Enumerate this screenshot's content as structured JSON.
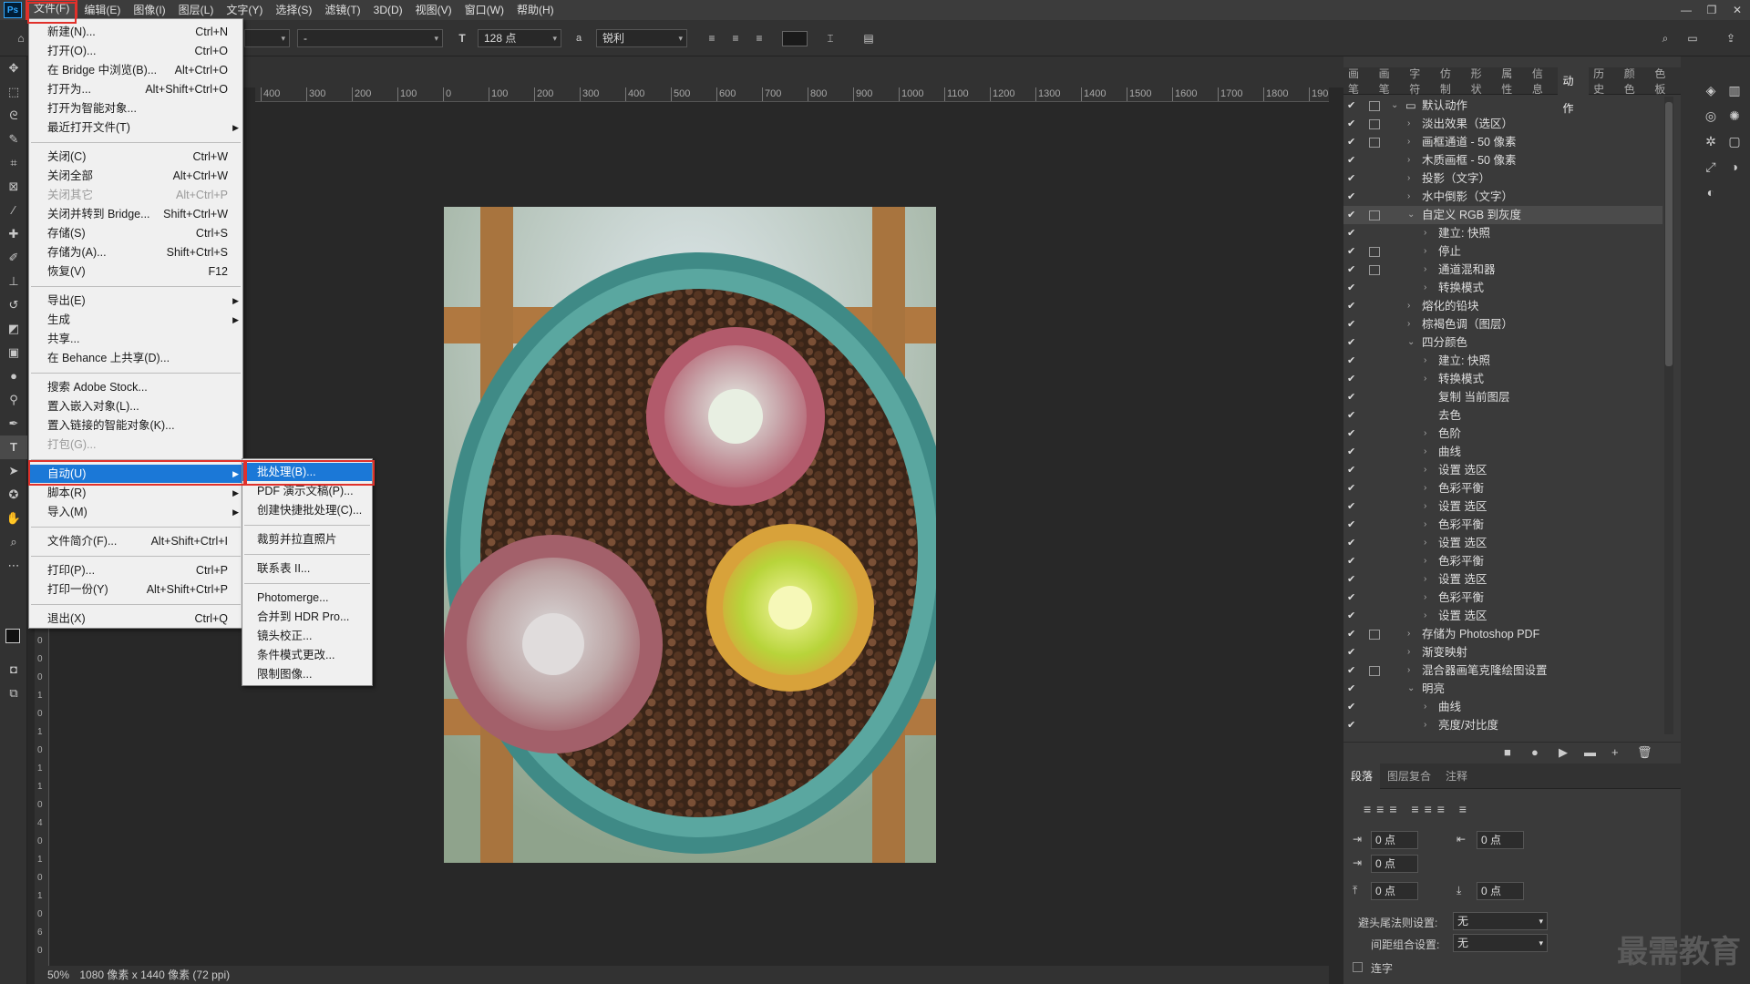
{
  "menubar": {
    "logo": "Ps",
    "items": [
      "文件(F)",
      "编辑(E)",
      "图像(I)",
      "图层(L)",
      "文字(Y)",
      "选择(S)",
      "滤镜(T)",
      "3D(D)",
      "视图(V)",
      "窗口(W)",
      "帮助(H)"
    ],
    "window_controls": [
      "—",
      "❐",
      "✕"
    ]
  },
  "options": {
    "font_style": "-",
    "font_size": "128 点",
    "aa_label": "a",
    "antialias": "锐利"
  },
  "ruler_top": [
    "400",
    "300",
    "200",
    "100",
    "0",
    "100",
    "200",
    "300",
    "400",
    "500",
    "600",
    "700",
    "800",
    "900",
    "1000",
    "1100",
    "1200",
    "1300",
    "1400",
    "1500",
    "1600",
    "1700",
    "1800",
    "190"
  ],
  "ruler_left": [
    "0",
    "0",
    "0",
    "1",
    "0",
    "1",
    "0",
    "1",
    "1",
    "0",
    "4",
    "0",
    "1",
    "0",
    "1",
    "0",
    "6",
    "0"
  ],
  "file_menu": {
    "items": [
      {
        "label": "新建(N)...",
        "shortcut": "Ctrl+N"
      },
      {
        "label": "打开(O)...",
        "shortcut": "Ctrl+O"
      },
      {
        "label": "在 Bridge 中浏览(B)...",
        "shortcut": "Alt+Ctrl+O"
      },
      {
        "label": "打开为...",
        "shortcut": "Alt+Shift+Ctrl+O"
      },
      {
        "label": "打开为智能对象...",
        "shortcut": ""
      },
      {
        "label": "最近打开文件(T)",
        "shortcut": "",
        "submenu": true
      },
      {
        "label": "关闭(C)",
        "shortcut": "Ctrl+W"
      },
      {
        "label": "关闭全部",
        "shortcut": "Alt+Ctrl+W"
      },
      {
        "label": "关闭其它",
        "shortcut": "Alt+Ctrl+P",
        "disabled": true
      },
      {
        "label": "关闭并转到 Bridge...",
        "shortcut": "Shift+Ctrl+W"
      },
      {
        "label": "存储(S)",
        "shortcut": "Ctrl+S"
      },
      {
        "label": "存储为(A)...",
        "shortcut": "Shift+Ctrl+S"
      },
      {
        "label": "恢复(V)",
        "shortcut": "F12"
      },
      {
        "label": "导出(E)",
        "shortcut": "",
        "submenu": true
      },
      {
        "label": "生成",
        "shortcut": "",
        "submenu": true
      },
      {
        "label": "共享...",
        "shortcut": ""
      },
      {
        "label": "在 Behance 上共享(D)...",
        "shortcut": ""
      },
      {
        "label": "搜索 Adobe Stock...",
        "shortcut": ""
      },
      {
        "label": "置入嵌入对象(L)...",
        "shortcut": ""
      },
      {
        "label": "置入链接的智能对象(K)...",
        "shortcut": ""
      },
      {
        "label": "打包(G)...",
        "shortcut": "",
        "disabled": true
      },
      {
        "label": "自动(U)",
        "shortcut": "",
        "submenu": true,
        "highlighted": true
      },
      {
        "label": "脚本(R)",
        "shortcut": "",
        "submenu": true
      },
      {
        "label": "导入(M)",
        "shortcut": "",
        "submenu": true
      },
      {
        "label": "文件简介(F)...",
        "shortcut": "Alt+Shift+Ctrl+I"
      },
      {
        "label": "打印(P)...",
        "shortcut": "Ctrl+P"
      },
      {
        "label": "打印一份(Y)",
        "shortcut": "Alt+Shift+Ctrl+P"
      },
      {
        "label": "退出(X)",
        "shortcut": "Ctrl+Q"
      }
    ]
  },
  "auto_menu": {
    "items": [
      {
        "label": "批处理(B)...",
        "highlighted": true
      },
      {
        "label": "PDF 演示文稿(P)..."
      },
      {
        "label": "创建快捷批处理(C)..."
      },
      {
        "label": "裁剪并拉直照片"
      },
      {
        "label": "联系表 II..."
      },
      {
        "label": "Photomerge..."
      },
      {
        "label": "合并到 HDR Pro..."
      },
      {
        "label": "镜头校正..."
      },
      {
        "label": "条件模式更改..."
      },
      {
        "label": "限制图像..."
      }
    ]
  },
  "panel_tabs": [
    "画笔",
    "画笔",
    "字符",
    "仿制",
    "形状",
    "属性",
    "信息",
    "动作",
    "历史",
    "颜色",
    "色板"
  ],
  "actions": [
    {
      "label": "默认动作",
      "level": 0,
      "expand": "open",
      "dialog": true,
      "folder": true
    },
    {
      "label": "淡出效果（选区）",
      "level": 1,
      "expand": "closed",
      "dialog": true
    },
    {
      "label": "画框通道 - 50 像素",
      "level": 1,
      "expand": "closed",
      "dialog": true
    },
    {
      "label": "木质画框 - 50 像素",
      "level": 1,
      "expand": "closed",
      "dialog": false
    },
    {
      "label": "投影（文字）",
      "level": 1,
      "expand": "closed",
      "dialog": false
    },
    {
      "label": "水中倒影（文字）",
      "level": 1,
      "expand": "closed",
      "dialog": false
    },
    {
      "label": "自定义 RGB 到灰度",
      "level": 1,
      "expand": "open",
      "dialog": true,
      "selected": true
    },
    {
      "label": "建立: 快照",
      "level": 2,
      "expand": "closed",
      "dialog": false
    },
    {
      "label": "停止",
      "level": 2,
      "expand": "closed",
      "dialog": true
    },
    {
      "label": "通道混和器",
      "level": 2,
      "expand": "closed",
      "dialog": true
    },
    {
      "label": "转换模式",
      "level": 2,
      "expand": "closed",
      "dialog": false
    },
    {
      "label": "熔化的铅块",
      "level": 1,
      "expand": "closed",
      "dialog": false
    },
    {
      "label": "棕褐色调（图层）",
      "level": 1,
      "expand": "closed",
      "dialog": false
    },
    {
      "label": "四分颜色",
      "level": 1,
      "expand": "open",
      "dialog": false
    },
    {
      "label": "建立: 快照",
      "level": 2,
      "expand": "closed",
      "dialog": false
    },
    {
      "label": "转换模式",
      "level": 2,
      "expand": "closed",
      "dialog": false
    },
    {
      "label": "复制 当前图层",
      "level": 2,
      "expand": "none",
      "dialog": false
    },
    {
      "label": "去色",
      "level": 2,
      "expand": "none",
      "dialog": false
    },
    {
      "label": "色阶",
      "level": 2,
      "expand": "closed",
      "dialog": false
    },
    {
      "label": "曲线",
      "level": 2,
      "expand": "closed",
      "dialog": false
    },
    {
      "label": "设置 选区",
      "level": 2,
      "expand": "closed",
      "dialog": false
    },
    {
      "label": "色彩平衡",
      "level": 2,
      "expand": "closed",
      "dialog": false
    },
    {
      "label": "设置 选区",
      "level": 2,
      "expand": "closed",
      "dialog": false
    },
    {
      "label": "色彩平衡",
      "level": 2,
      "expand": "closed",
      "dialog": false
    },
    {
      "label": "设置 选区",
      "level": 2,
      "expand": "closed",
      "dialog": false
    },
    {
      "label": "色彩平衡",
      "level": 2,
      "expand": "closed",
      "dialog": false
    },
    {
      "label": "设置 选区",
      "level": 2,
      "expand": "closed",
      "dialog": false
    },
    {
      "label": "色彩平衡",
      "level": 2,
      "expand": "closed",
      "dialog": false
    },
    {
      "label": "设置 选区",
      "level": 2,
      "expand": "closed",
      "dialog": false
    },
    {
      "label": "存储为 Photoshop PDF",
      "level": 1,
      "expand": "closed",
      "dialog": true
    },
    {
      "label": "渐变映射",
      "level": 1,
      "expand": "closed",
      "dialog": false
    },
    {
      "label": "混合器画笔克隆绘图设置",
      "level": 1,
      "expand": "closed",
      "dialog": true
    },
    {
      "label": "明亮",
      "level": 1,
      "expand": "open",
      "dialog": false
    },
    {
      "label": "曲线",
      "level": 2,
      "expand": "closed",
      "dialog": false
    },
    {
      "label": "亮度/对比度",
      "level": 2,
      "expand": "closed",
      "dialog": false
    }
  ],
  "actions_footer": [
    "■",
    "●",
    "▶",
    "▬",
    "+",
    "🗑"
  ],
  "paragraph": {
    "tabs": [
      "段落",
      "图层复合",
      "注释"
    ],
    "indent_left": "0 点",
    "indent_right": "0 点",
    "indent_first": "0 点",
    "space_before": "0 点",
    "space_after": "0 点",
    "kinsoku_label": "避头尾法则设置:",
    "kinsoku_value": "无",
    "mojikumi_label": "间距组合设置:",
    "mojikumi_value": "无",
    "hyphenate_label": "连字"
  },
  "status": {
    "zoom": "50%",
    "info": "1080 像素 x 1440 像素 (72 ppi)"
  },
  "watermark": "最需教育",
  "colors": {
    "highlight": "#1b78d7",
    "annotation": "#e0312b",
    "ui_dark": "#282828"
  }
}
